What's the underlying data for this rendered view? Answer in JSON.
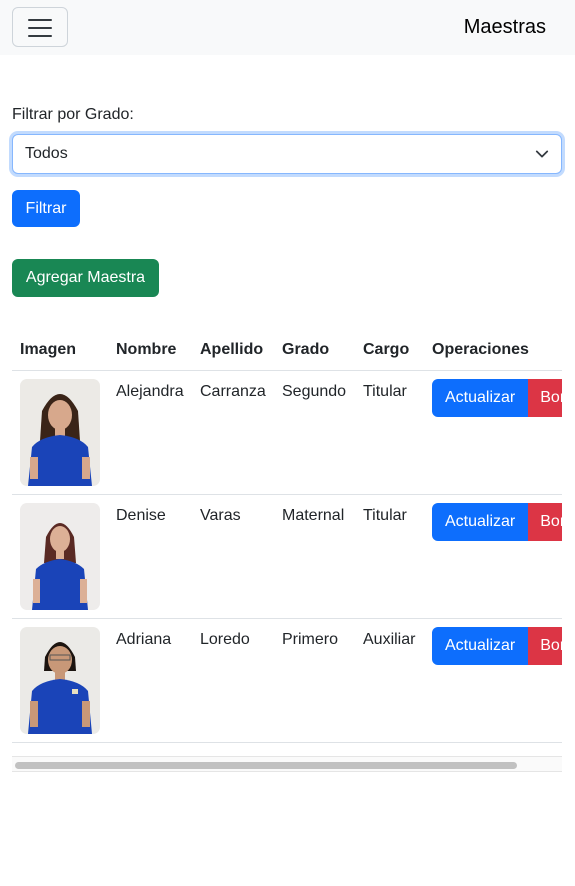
{
  "navbar": {
    "brand": "Maestras",
    "menu_icon": "hamburger-icon"
  },
  "filter": {
    "label": "Filtrar por Grado:",
    "selected": "Todos",
    "button": "Filtrar"
  },
  "add_button": "Agregar Maestra",
  "table": {
    "headers": [
      "Imagen",
      "Nombre",
      "Apellido",
      "Grado",
      "Cargo",
      "Operaciones"
    ],
    "rows": [
      {
        "nombre": "Alejandra",
        "apellido": "Carranza",
        "grado": "Segundo",
        "cargo": "Titular",
        "update": "Actualizar",
        "delete": "Borrar"
      },
      {
        "nombre": "Denise",
        "apellido": "Varas",
        "grado": "Maternal",
        "cargo": "Titular",
        "update": "Actualizar",
        "delete": "Borrar"
      },
      {
        "nombre": "Adriana",
        "apellido": "Loredo",
        "grado": "Primero",
        "cargo": "Auxiliar",
        "update": "Actualizar",
        "delete": "Borrar"
      }
    ]
  },
  "colors": {
    "primary": "#0d6efd",
    "success": "#198754",
    "danger": "#dc3545",
    "navbar_bg": "#f8f9fa"
  }
}
